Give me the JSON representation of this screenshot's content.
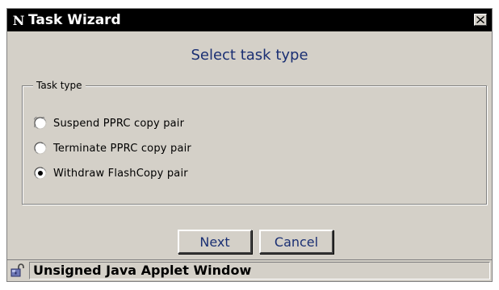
{
  "window": {
    "title": "Task Wizard",
    "app_icon": "netscape-n-icon",
    "close_icon": "close-icon"
  },
  "heading": "Select task type",
  "task_type_group": {
    "label": "Task type",
    "selected_index": 2,
    "options": [
      {
        "label": "Suspend PPRC copy pair",
        "selected": false
      },
      {
        "label": "Terminate PPRC copy pair",
        "selected": false
      },
      {
        "label": "Withdraw FlashCopy pair",
        "selected": true
      }
    ]
  },
  "buttons": {
    "next_label": "Next",
    "cancel_label": "Cancel"
  },
  "status_bar": {
    "icon": "unlocked-icon",
    "text": "Unsigned Java Applet Window"
  },
  "colors": {
    "title_bar": "#000000",
    "dialog_background": "#d4d0c8",
    "heading_text": "#1a2f73",
    "button_text": "#1a2f73"
  }
}
